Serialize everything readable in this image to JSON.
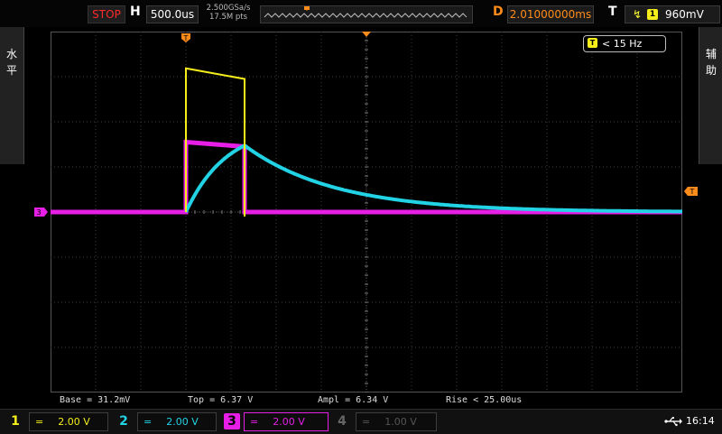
{
  "status": {
    "run_state": "STOP",
    "run_state_color": "#ff2a2a"
  },
  "horizontal": {
    "label": "H",
    "timebase": "500.0us",
    "sample_rate": "2.500GSa/s",
    "memory_depth": "17.5M pts"
  },
  "delay": {
    "label": "D",
    "value": "2.01000000ms",
    "color": "#ff8c1a"
  },
  "trigger": {
    "label": "T",
    "edge_icon": "rising-edge-icon",
    "source": "1",
    "level": "960mV",
    "frequency": "< 15 Hz"
  },
  "side_tabs": {
    "left": [
      "水",
      "平"
    ],
    "right": [
      "辅",
      "助"
    ]
  },
  "measurements": {
    "base": "Base = 31.2mV",
    "top": "Top = 6.37 V",
    "ampl": "Ampl = 6.34 V",
    "rise": "Rise < 25.00us"
  },
  "channels": [
    {
      "number": "1",
      "coupling": "=",
      "scale": "2.00 V",
      "color": "#f5ee1b",
      "active": true
    },
    {
      "number": "2",
      "coupling": "=",
      "scale": "2.00 V",
      "color": "#22d3e6",
      "active": true
    },
    {
      "number": "3",
      "coupling": "=",
      "scale": "2.00 V",
      "color": "#e61ee6",
      "active": true,
      "selected": true
    },
    {
      "number": "4",
      "coupling": "=",
      "scale": "1.00 V",
      "color": "#555555",
      "active": false
    }
  ],
  "clock": "16:14",
  "colors": {
    "grid": "#3c3c3c",
    "trigger_marker": "#ff8c1a",
    "ch1": "#f5ee1b",
    "ch2": "#22d3e6",
    "ch3": "#e61ee6"
  },
  "waveforms": {
    "ch1": {
      "low_v": 0.0,
      "high_v": 6.37,
      "high_v_end": 5.9,
      "pulse_start_ms": 0.0,
      "pulse_end_ms": 0.65
    },
    "ch2": {
      "peak_v": 2.95,
      "tau_ms": 1.0,
      "pulse_start_ms": 0.0,
      "pulse_end_ms": 0.65
    },
    "ch3": {
      "low_v": 0.0,
      "high_v": 3.1,
      "high_v_end": 2.9,
      "pulse_start_ms": 0.0,
      "pulse_end_ms": 0.65
    },
    "time_per_div_ms": 0.5,
    "volts_per_div": 2.0,
    "trigger_time_ms": 0.0
  }
}
